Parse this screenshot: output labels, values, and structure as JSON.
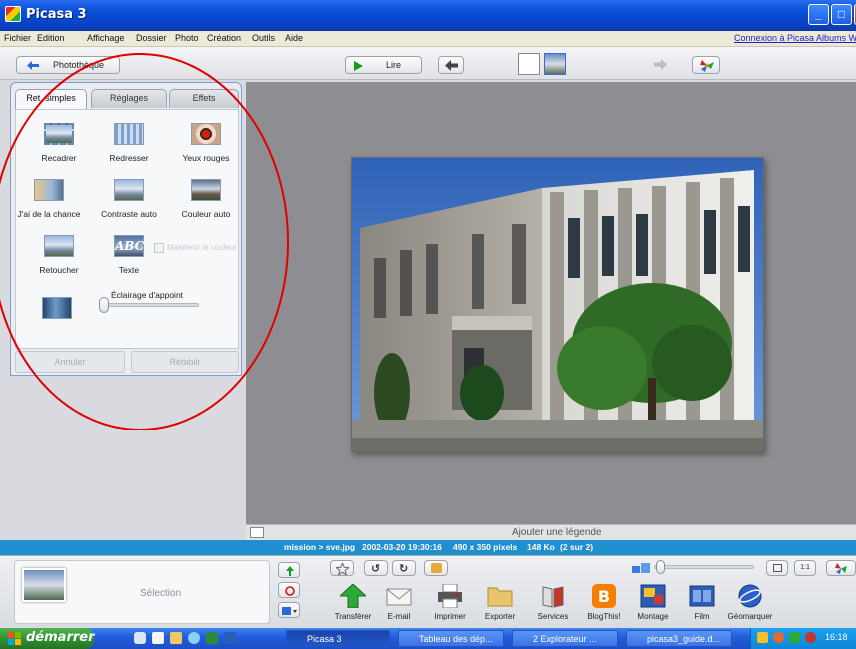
{
  "window": {
    "title": "Picasa 3"
  },
  "menu": {
    "items": [
      "Fichier",
      "Edition",
      "Affichage",
      "Dossier",
      "Photo",
      "Création",
      "Outils",
      "Aide"
    ],
    "link": "Connexion à Picasa Albums Web"
  },
  "toolbar": {
    "library": "Photothèque",
    "play": "Lire"
  },
  "left_panel": {
    "tabs": [
      "Ret. simples",
      "Réglages",
      "Effets"
    ],
    "tools": [
      "Recadrer",
      "Redresser",
      "Yeux rouges",
      "J'ai de la chance",
      "Contraste auto",
      "Couleur auto",
      "Retoucher",
      "Texte"
    ],
    "color_checkbox": "Maintenir la couleur",
    "fill_light_label": "Éclairage d'appoint",
    "fill_light_level": 0.0,
    "undo": "Annuler",
    "redo": "Rétablir"
  },
  "caption": {
    "placeholder": "Ajouter une légende"
  },
  "info": {
    "path": "mission > sve.jpg",
    "datetime": "2002-03-20 19:30:16",
    "dimensions": "490 x 350 pixels",
    "size": "148 Ko",
    "position": "(2 sur 2)"
  },
  "tray": {
    "selection_label": "Sélection",
    "actions": [
      "Transférer",
      "E-mail",
      "Imprimer",
      "Exporter",
      "Services",
      "BlogThis!",
      "Montage",
      "Film",
      "Géomarquer"
    ],
    "zoom_label": "1:1"
  },
  "taskbar": {
    "start": "démarrer",
    "tasks": [
      "Picasa 3",
      "Tableau des dép...",
      "2 Explorateur ...",
      "picasa3_guide.d..."
    ],
    "clock": "16:18"
  },
  "colors": {
    "accent": "#1f8fcf",
    "annotation": "#e00000"
  }
}
